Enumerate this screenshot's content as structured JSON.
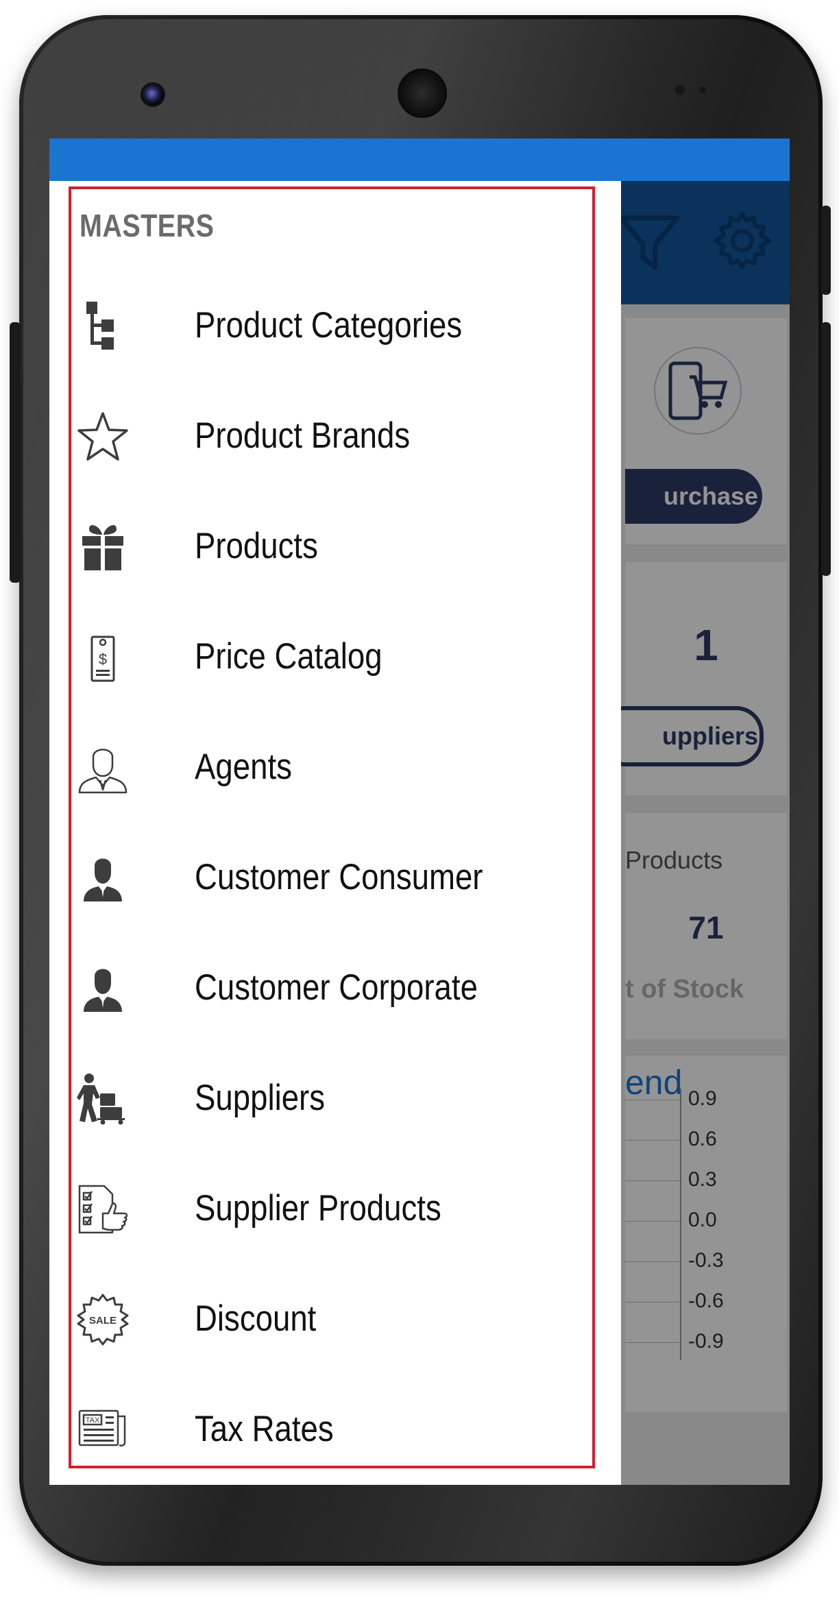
{
  "drawer": {
    "section_title": "MASTERS",
    "items": [
      {
        "label": "Product Categories",
        "icon": "hierarchy-icon"
      },
      {
        "label": "Product Brands",
        "icon": "star-icon"
      },
      {
        "label": "Products",
        "icon": "gift-icon"
      },
      {
        "label": "Price Catalog",
        "icon": "price-tag-icon"
      },
      {
        "label": "Agents",
        "icon": "agent-icon"
      },
      {
        "label": "Customer Consumer",
        "icon": "customer-icon"
      },
      {
        "label": "Customer Corporate",
        "icon": "customer-icon"
      },
      {
        "label": "Suppliers",
        "icon": "supplier-cart-icon"
      },
      {
        "label": "Supplier Products",
        "icon": "checklist-thumbs-up-icon"
      },
      {
        "label": "Discount",
        "icon": "sale-badge-icon"
      },
      {
        "label": "Tax Rates",
        "icon": "tax-document-icon"
      }
    ]
  },
  "background_app": {
    "header_icons": [
      "filter-icon",
      "gear-icon"
    ],
    "purchase_button": "urchase",
    "suppliers_count": "1",
    "suppliers_button": "uppliers",
    "products_label": "Products",
    "out_of_stock_count": "71",
    "out_of_stock_label": "t of Stock",
    "chart_title_fragment": "end",
    "chart_ticks": [
      "0.9",
      "0.6",
      "0.3",
      "0.0",
      "-0.3",
      "-0.6",
      "-0.9"
    ]
  },
  "colors": {
    "status_bar": "#1b75d0",
    "app_header": "#13569c",
    "highlight_border": "#d0202d",
    "accent_dark": "#2d3a66"
  }
}
